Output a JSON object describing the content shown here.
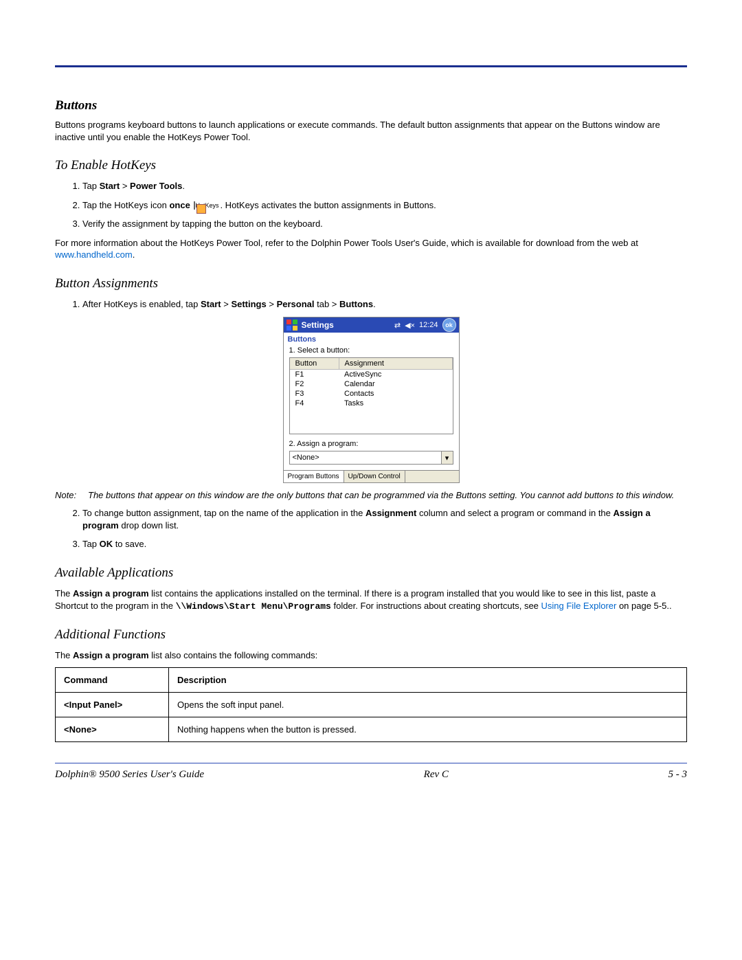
{
  "headings": {
    "buttons": "Buttons",
    "enable": "To Enable HotKeys",
    "assign": "Button Assignments",
    "apps": "Available Applications",
    "funcs": "Additional Functions"
  },
  "paragraphs": {
    "intro": "Buttons programs keyboard buttons  to launch applications or execute commands. The default button assignments that appear on the Buttons window are inactive until you enable the HotKeys Power Tool.",
    "more_info_pre": "For more information about the HotKeys Power Tool, refer to the Dolphin Power Tools User's Guide, which is available for download from the web at ",
    "more_info_link": "www.handheld.com",
    "more_info_post": ".",
    "apps_pre": "The ",
    "apps_bold1": "Assign a program",
    "apps_mid1": " list contains the applications installed on the terminal. If there is a program installed that you would like to see in this list, paste a Shortcut to the program in the ",
    "apps_path": "\\\\Windows\\Start Menu\\Programs",
    "apps_mid2": " folder. For instructions about creating shortcuts, see ",
    "apps_link": "Using File Explorer",
    "apps_post": " on page 5-5..",
    "funcs_pre": "The ",
    "funcs_bold": "Assign a program",
    "funcs_post": " list also contains the following commands:"
  },
  "enable_steps": {
    "s1_pre": "Tap ",
    "s1_b1": "Start",
    "s1_gt": " > ",
    "s1_b2": "Power Tools",
    "s1_post": ".",
    "s2_pre": "Tap the HotKeys icon ",
    "s2_b": "once",
    "s2_icon_label": "HotKeys",
    "s2_post": ". HotKeys activates the button assignments in Buttons.",
    "s3": "Verify the assignment by tapping the button on the keyboard."
  },
  "assign_steps": {
    "s1_pre": "After HotKeys is enabled, tap ",
    "s1_b1": "Start",
    "s1_gt1": " > ",
    "s1_b2": "Settings",
    "s1_gt2": " > ",
    "s1_b3": "Personal",
    "s1_tab": " tab > ",
    "s1_b4": "Buttons",
    "s1_post": ".",
    "s2_pre": "To change button assignment, tap on the name of the application in the ",
    "s2_b1": "Assignment",
    "s2_mid": " column and select a program or command in the ",
    "s2_b2": "Assign a program",
    "s2_post": " drop down list.",
    "s3_pre": "Tap ",
    "s3_b": "OK",
    "s3_post": " to save."
  },
  "note": {
    "label": "Note:",
    "text": "The buttons that appear on this window are the only buttons that can be programmed via the Buttons setting. You cannot add buttons to this window."
  },
  "ppc": {
    "title": "Settings",
    "time": "12:24",
    "ok": "ok",
    "subtitle": "Buttons",
    "label1": "1. Select a button:",
    "col_button": "Button",
    "col_assign": "Assignment",
    "rows": [
      {
        "b": "F1",
        "a": "ActiveSync"
      },
      {
        "b": "F2",
        "a": "Calendar"
      },
      {
        "b": "F3",
        "a": "Contacts"
      },
      {
        "b": "F4",
        "a": "Tasks"
      }
    ],
    "label2": "2. Assign a program:",
    "select_value": "<None>",
    "tab1": "Program Buttons",
    "tab2": "Up/Down Control"
  },
  "cmd_table": {
    "h1": "Command",
    "h2": "Description",
    "rows": [
      {
        "cmd": "<Input Panel>",
        "desc": "Opens the soft input panel."
      },
      {
        "cmd": "<None>",
        "desc": "Nothing happens when the button is pressed."
      }
    ]
  },
  "footer": {
    "left": "Dolphin® 9500 Series User's Guide",
    "center": "Rev C",
    "right": "5 - 3"
  }
}
